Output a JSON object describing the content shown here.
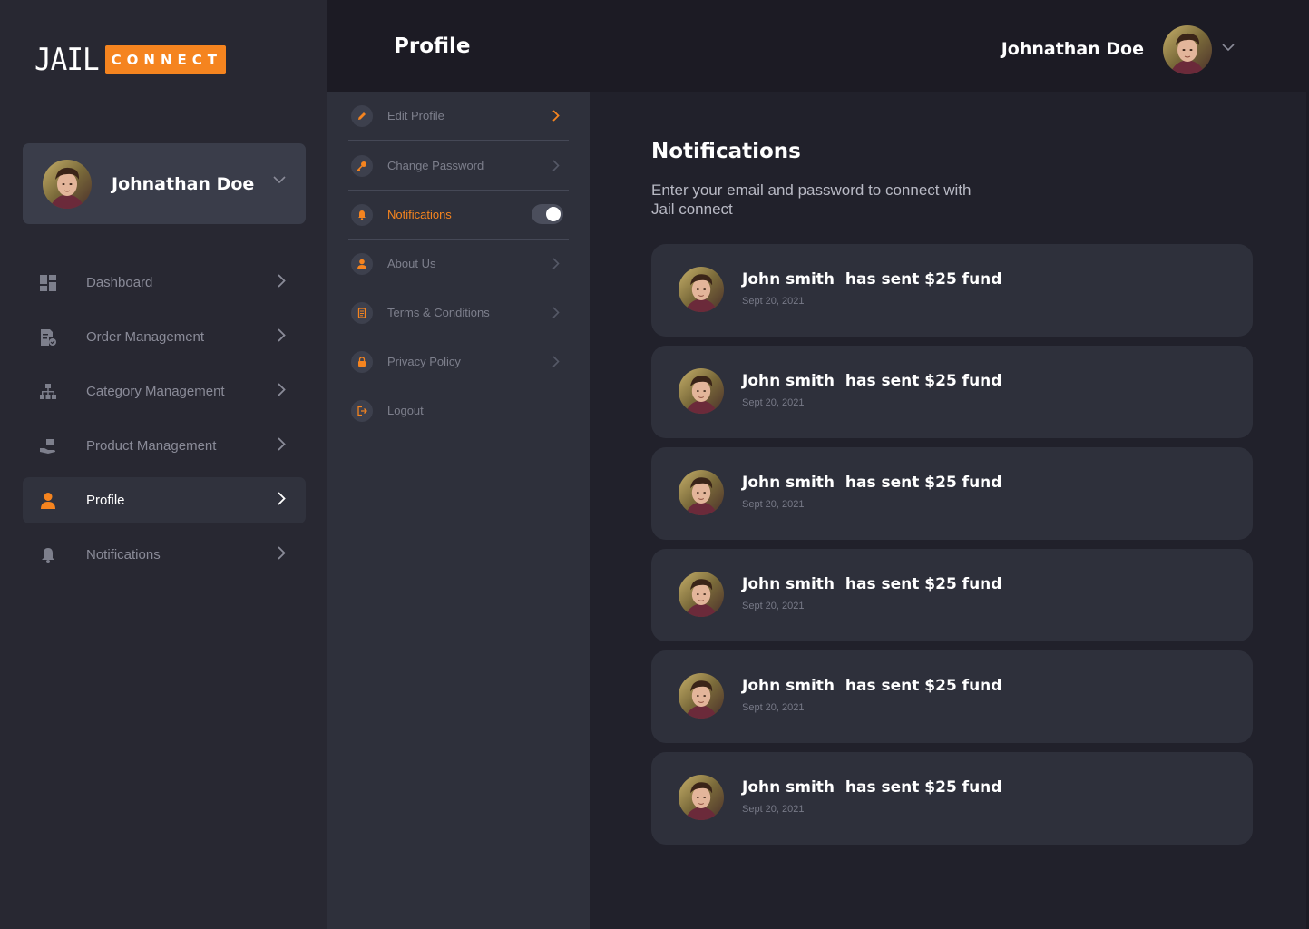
{
  "brand": {
    "logo_text": "JAIL",
    "badge_text": "CONNECT",
    "accent": "#f5841f"
  },
  "user": {
    "name": "Johnathan Doe"
  },
  "sidebar": {
    "items": [
      {
        "label": "Dashboard",
        "icon": "dashboard-icon",
        "active": false
      },
      {
        "label": "Order Management",
        "icon": "order-icon",
        "active": false
      },
      {
        "label": "Category Management",
        "icon": "category-icon",
        "active": false
      },
      {
        "label": "Product Management",
        "icon": "product-icon",
        "active": false
      },
      {
        "label": "Profile",
        "icon": "profile-icon",
        "active": true
      },
      {
        "label": "Notifications",
        "icon": "bell-icon",
        "active": false
      }
    ]
  },
  "header": {
    "title": "Profile",
    "user_name": "Johnathan Doe"
  },
  "profile_menu": {
    "items": [
      {
        "label": "Edit Profile",
        "icon": "pencil-icon"
      },
      {
        "label": "Change Password",
        "icon": "key-icon"
      },
      {
        "label": "Notifications",
        "icon": "bell-icon",
        "toggle_on": true
      },
      {
        "label": "About Us",
        "icon": "user-icon"
      },
      {
        "label": "Terms & Conditions",
        "icon": "document-icon"
      },
      {
        "label": "Privacy Policy",
        "icon": "lock-icon"
      },
      {
        "label": "Logout",
        "icon": "logout-icon"
      }
    ]
  },
  "content": {
    "title": "Notifications",
    "description": "Enter your email and password to connect with Jail connect",
    "notifications": [
      {
        "sender": "John smith",
        "message": "has sent $25 fund",
        "date": "Sept 20, 2021"
      },
      {
        "sender": "John smith",
        "message": "has sent $25 fund",
        "date": "Sept 20, 2021"
      },
      {
        "sender": "John smith",
        "message": "has sent $25 fund",
        "date": "Sept 20, 2021"
      },
      {
        "sender": "John smith",
        "message": "has sent $25 fund",
        "date": "Sept 20, 2021"
      },
      {
        "sender": "John smith",
        "message": "has sent $25 fund",
        "date": "Sept 20, 2021"
      },
      {
        "sender": "John smith",
        "message": "has sent $25 fund",
        "date": "Sept 20, 2021"
      }
    ]
  }
}
